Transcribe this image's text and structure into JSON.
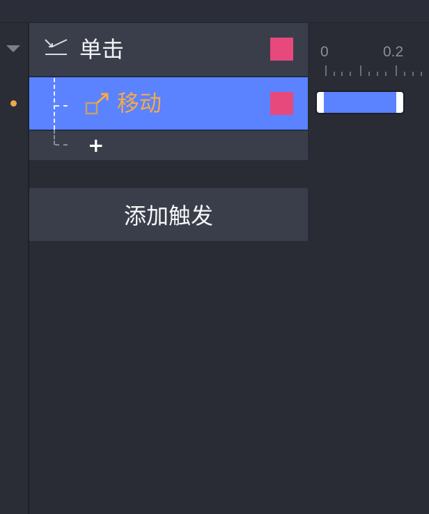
{
  "colors": {
    "background": "#292b35",
    "row_background": "#3a3e4a",
    "selected_row": "#5b82ff",
    "swatch": "#e8497d",
    "action_label": "#f4a94a",
    "dot": "#f0a946"
  },
  "tree": {
    "collapse_icon": "triangle-down-icon",
    "trigger": {
      "icon": "click-trigger-icon",
      "label": "单击"
    },
    "action": {
      "icon": "move-icon",
      "label": "移动",
      "selected": true
    },
    "add_action": {
      "label": "+"
    }
  },
  "add_trigger_button": {
    "label": "添加触发"
  },
  "timeline": {
    "ruler_labels": [
      "0",
      "0.2"
    ],
    "clip": {
      "start": 0,
      "end": 0.2
    }
  }
}
